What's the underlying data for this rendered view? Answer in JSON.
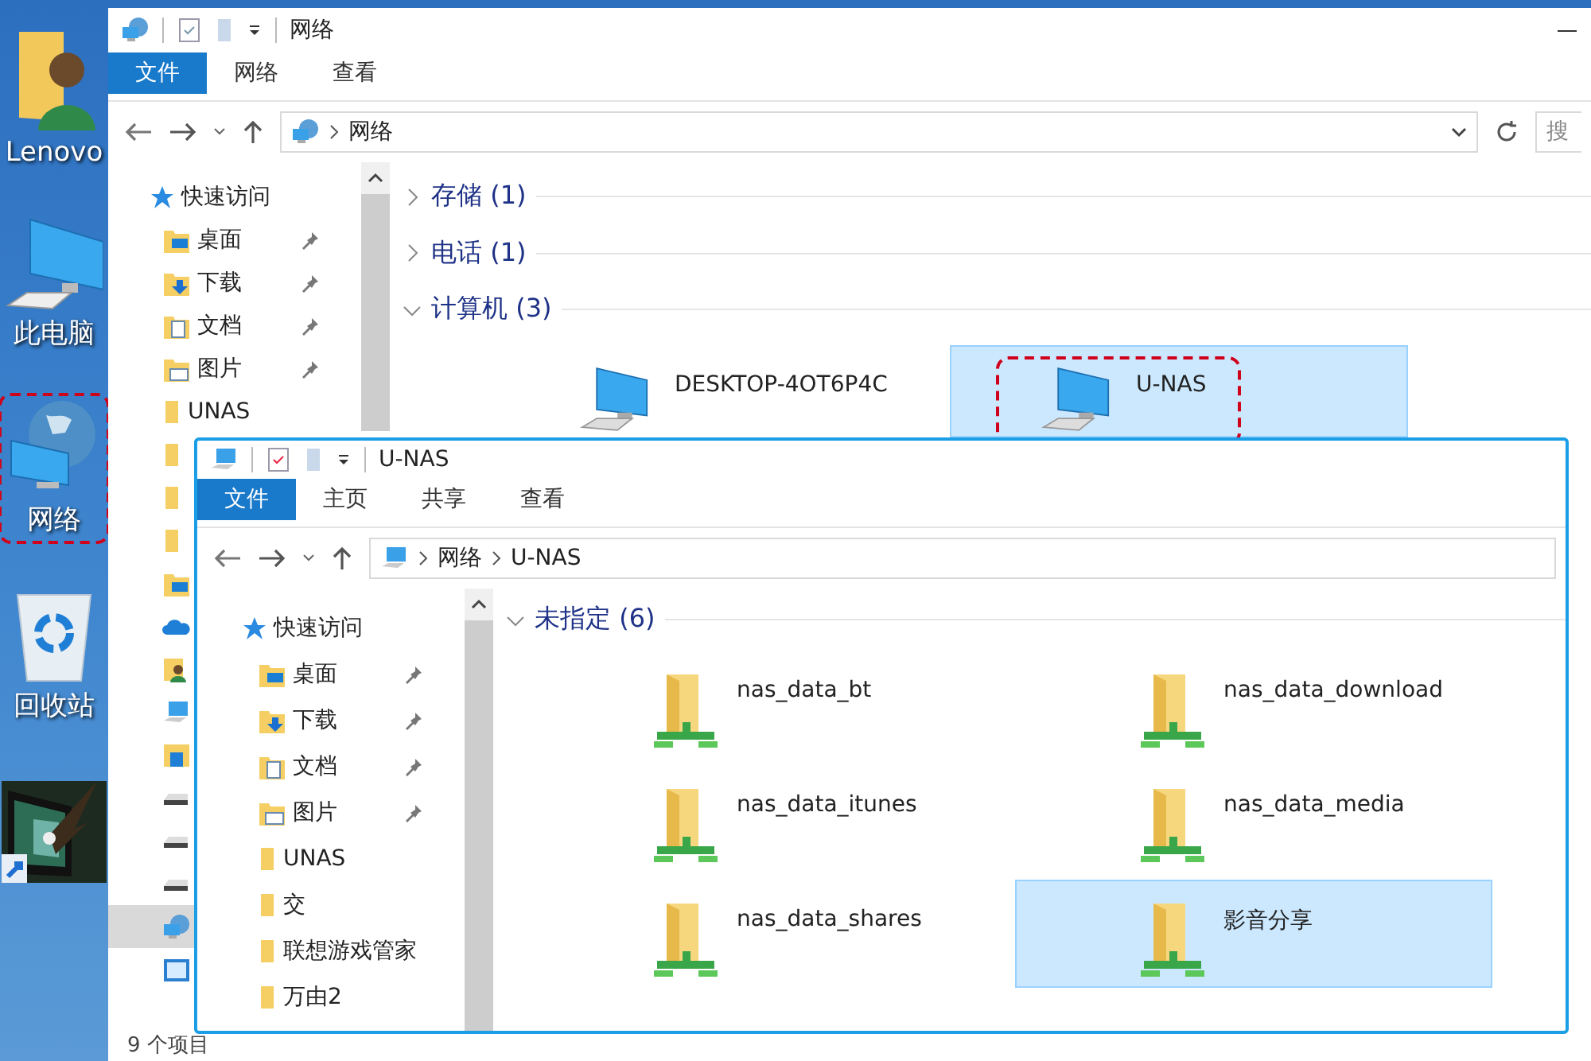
{
  "desktop_icons": [
    {
      "kind": "user-folder",
      "label": "Lenovo",
      "highlighted": false
    },
    {
      "kind": "computer",
      "label": "此电脑",
      "highlighted": false
    },
    {
      "kind": "network",
      "label": "网络",
      "highlighted": true
    },
    {
      "kind": "recycle",
      "label": "回收站",
      "highlighted": false
    },
    {
      "kind": "app",
      "highlighted": false
    }
  ],
  "back_window": {
    "title": "网络",
    "ribbon_tabs": [
      {
        "label": "文件",
        "selected": true
      },
      {
        "label": "网络",
        "selected": false
      },
      {
        "label": "查看",
        "selected": false
      }
    ],
    "address": {
      "path": [
        "网络"
      ]
    },
    "search": {
      "placeholder": "搜"
    },
    "nav": [
      {
        "kind": "quick",
        "label": "快速访问",
        "pinned": false
      },
      {
        "kind": "desktop",
        "label": "桌面",
        "pinned": true
      },
      {
        "kind": "download",
        "label": "下载",
        "pinned": true
      },
      {
        "kind": "docs",
        "label": "文档",
        "pinned": true
      },
      {
        "kind": "pictures",
        "label": "图片",
        "pinned": true
      },
      {
        "kind": "folder",
        "label": "UNAS",
        "pinned": false
      }
    ],
    "nav_icons": [
      {
        "kind": "folder",
        "selected": false
      },
      {
        "kind": "folder",
        "selected": false
      },
      {
        "kind": "folder",
        "selected": false
      },
      {
        "kind": "desktop",
        "selected": false
      },
      {
        "kind": "cloud",
        "selected": false
      },
      {
        "kind": "user",
        "selected": false
      },
      {
        "kind": "computer",
        "selected": false
      },
      {
        "kind": "library",
        "selected": false
      },
      {
        "kind": "drive",
        "selected": false
      },
      {
        "kind": "drive",
        "selected": false
      },
      {
        "kind": "drive",
        "selected": false
      },
      {
        "kind": "network",
        "selected": true
      },
      {
        "kind": "panel",
        "selected": false
      }
    ],
    "groups": [
      {
        "label": "存储 (1)",
        "expanded": false
      },
      {
        "label": "电话 (1)",
        "expanded": false
      },
      {
        "label": "计算机 (3)",
        "expanded": true,
        "items": [
          {
            "name": "DESKTOP-4OT6P4C",
            "selected": false,
            "highlighted": false
          },
          {
            "name": "U-NAS",
            "selected": true,
            "highlighted": true
          }
        ]
      }
    ],
    "status_bar": "9 个项目"
  },
  "front_window": {
    "title": "U-NAS",
    "ribbon_tabs": [
      {
        "label": "文件",
        "selected": true
      },
      {
        "label": "主页",
        "selected": false
      },
      {
        "label": "共享",
        "selected": false
      },
      {
        "label": "查看",
        "selected": false
      }
    ],
    "address": {
      "path": [
        "网络",
        "U-NAS"
      ]
    },
    "nav": [
      {
        "kind": "quick",
        "label": "快速访问",
        "pinned": false
      },
      {
        "kind": "desktop",
        "label": "桌面",
        "pinned": true
      },
      {
        "kind": "download",
        "label": "下载",
        "pinned": true
      },
      {
        "kind": "docs",
        "label": "文档",
        "pinned": true
      },
      {
        "kind": "pictures",
        "label": "图片",
        "pinned": true
      },
      {
        "kind": "folder",
        "label": "UNAS",
        "pinned": false
      },
      {
        "kind": "folder",
        "label": "交",
        "pinned": false
      },
      {
        "kind": "folder",
        "label": "联想游戏管家",
        "pinned": false
      },
      {
        "kind": "folder",
        "label": "万由2",
        "pinned": false
      }
    ],
    "groups": [
      {
        "label": "未指定 (6)",
        "expanded": true,
        "items": [
          {
            "name": "nas_data_bt",
            "selected": false,
            "highlighted": false
          },
          {
            "name": "nas_data_download",
            "selected": false,
            "highlighted": false
          },
          {
            "name": "nas_data_itunes",
            "selected": false,
            "highlighted": false
          },
          {
            "name": "nas_data_media",
            "selected": false,
            "highlighted": false
          },
          {
            "name": "nas_data_shares",
            "selected": false,
            "highlighted": false
          },
          {
            "name": "影音分享",
            "selected": true,
            "highlighted": false
          }
        ]
      }
    ]
  }
}
